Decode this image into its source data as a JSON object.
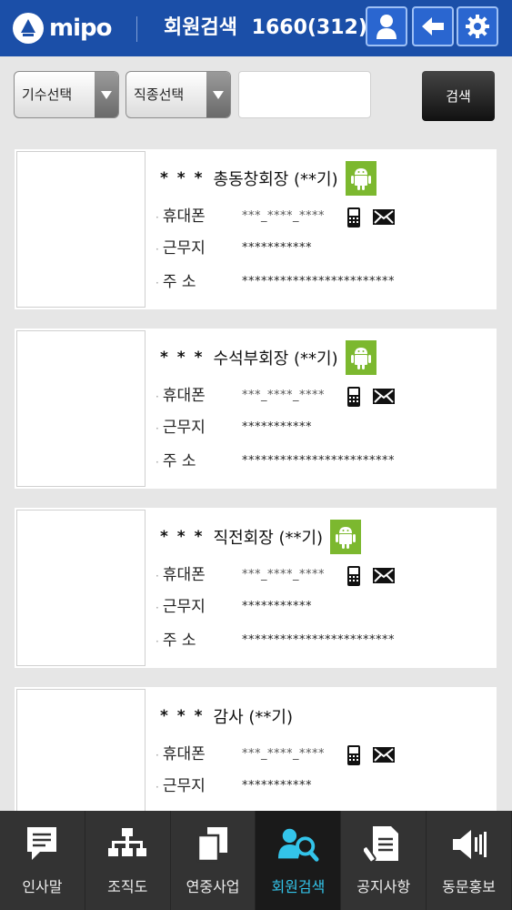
{
  "header": {
    "logo_text": "mipo",
    "title": "회원검색",
    "count": "1660(312)"
  },
  "filters": {
    "class_select_label": "기수선택",
    "job_select_label": "직종선택",
    "keyword_value": "",
    "search_label": "검색"
  },
  "field_labels": {
    "phone": "휴대폰",
    "work": "근무지",
    "address": "주  소"
  },
  "members": [
    {
      "stars": "* * *",
      "name": "총동창회장 (**기)",
      "phone": "***_****_****",
      "work": "***********",
      "address": "************************"
    },
    {
      "stars": "* * *",
      "name": "수석부회장 (**기)",
      "phone": "***_****_****",
      "work": "***********",
      "address": "************************"
    },
    {
      "stars": "* * *",
      "name": "직전회장 (**기)",
      "phone": "***_****_****",
      "work": "***********",
      "address": "************************"
    },
    {
      "stars": "* * *",
      "name": "감사 (**기)",
      "phone": "***_****_****",
      "work": "***********",
      "address": ""
    }
  ],
  "nav": [
    {
      "label": "인사말",
      "icon": "speech-bubble-icon"
    },
    {
      "label": "조직도",
      "icon": "org-chart-icon"
    },
    {
      "label": "연중사업",
      "icon": "documents-icon"
    },
    {
      "label": "회원검색",
      "icon": "member-search-icon",
      "active": true
    },
    {
      "label": "공지사항",
      "icon": "notice-icon"
    },
    {
      "label": "동문홍보",
      "icon": "speaker-icon"
    }
  ],
  "colors": {
    "header_bg": "#1b4fa8",
    "active_nav": "#33c4ea",
    "android_green": "#7cb82f"
  }
}
